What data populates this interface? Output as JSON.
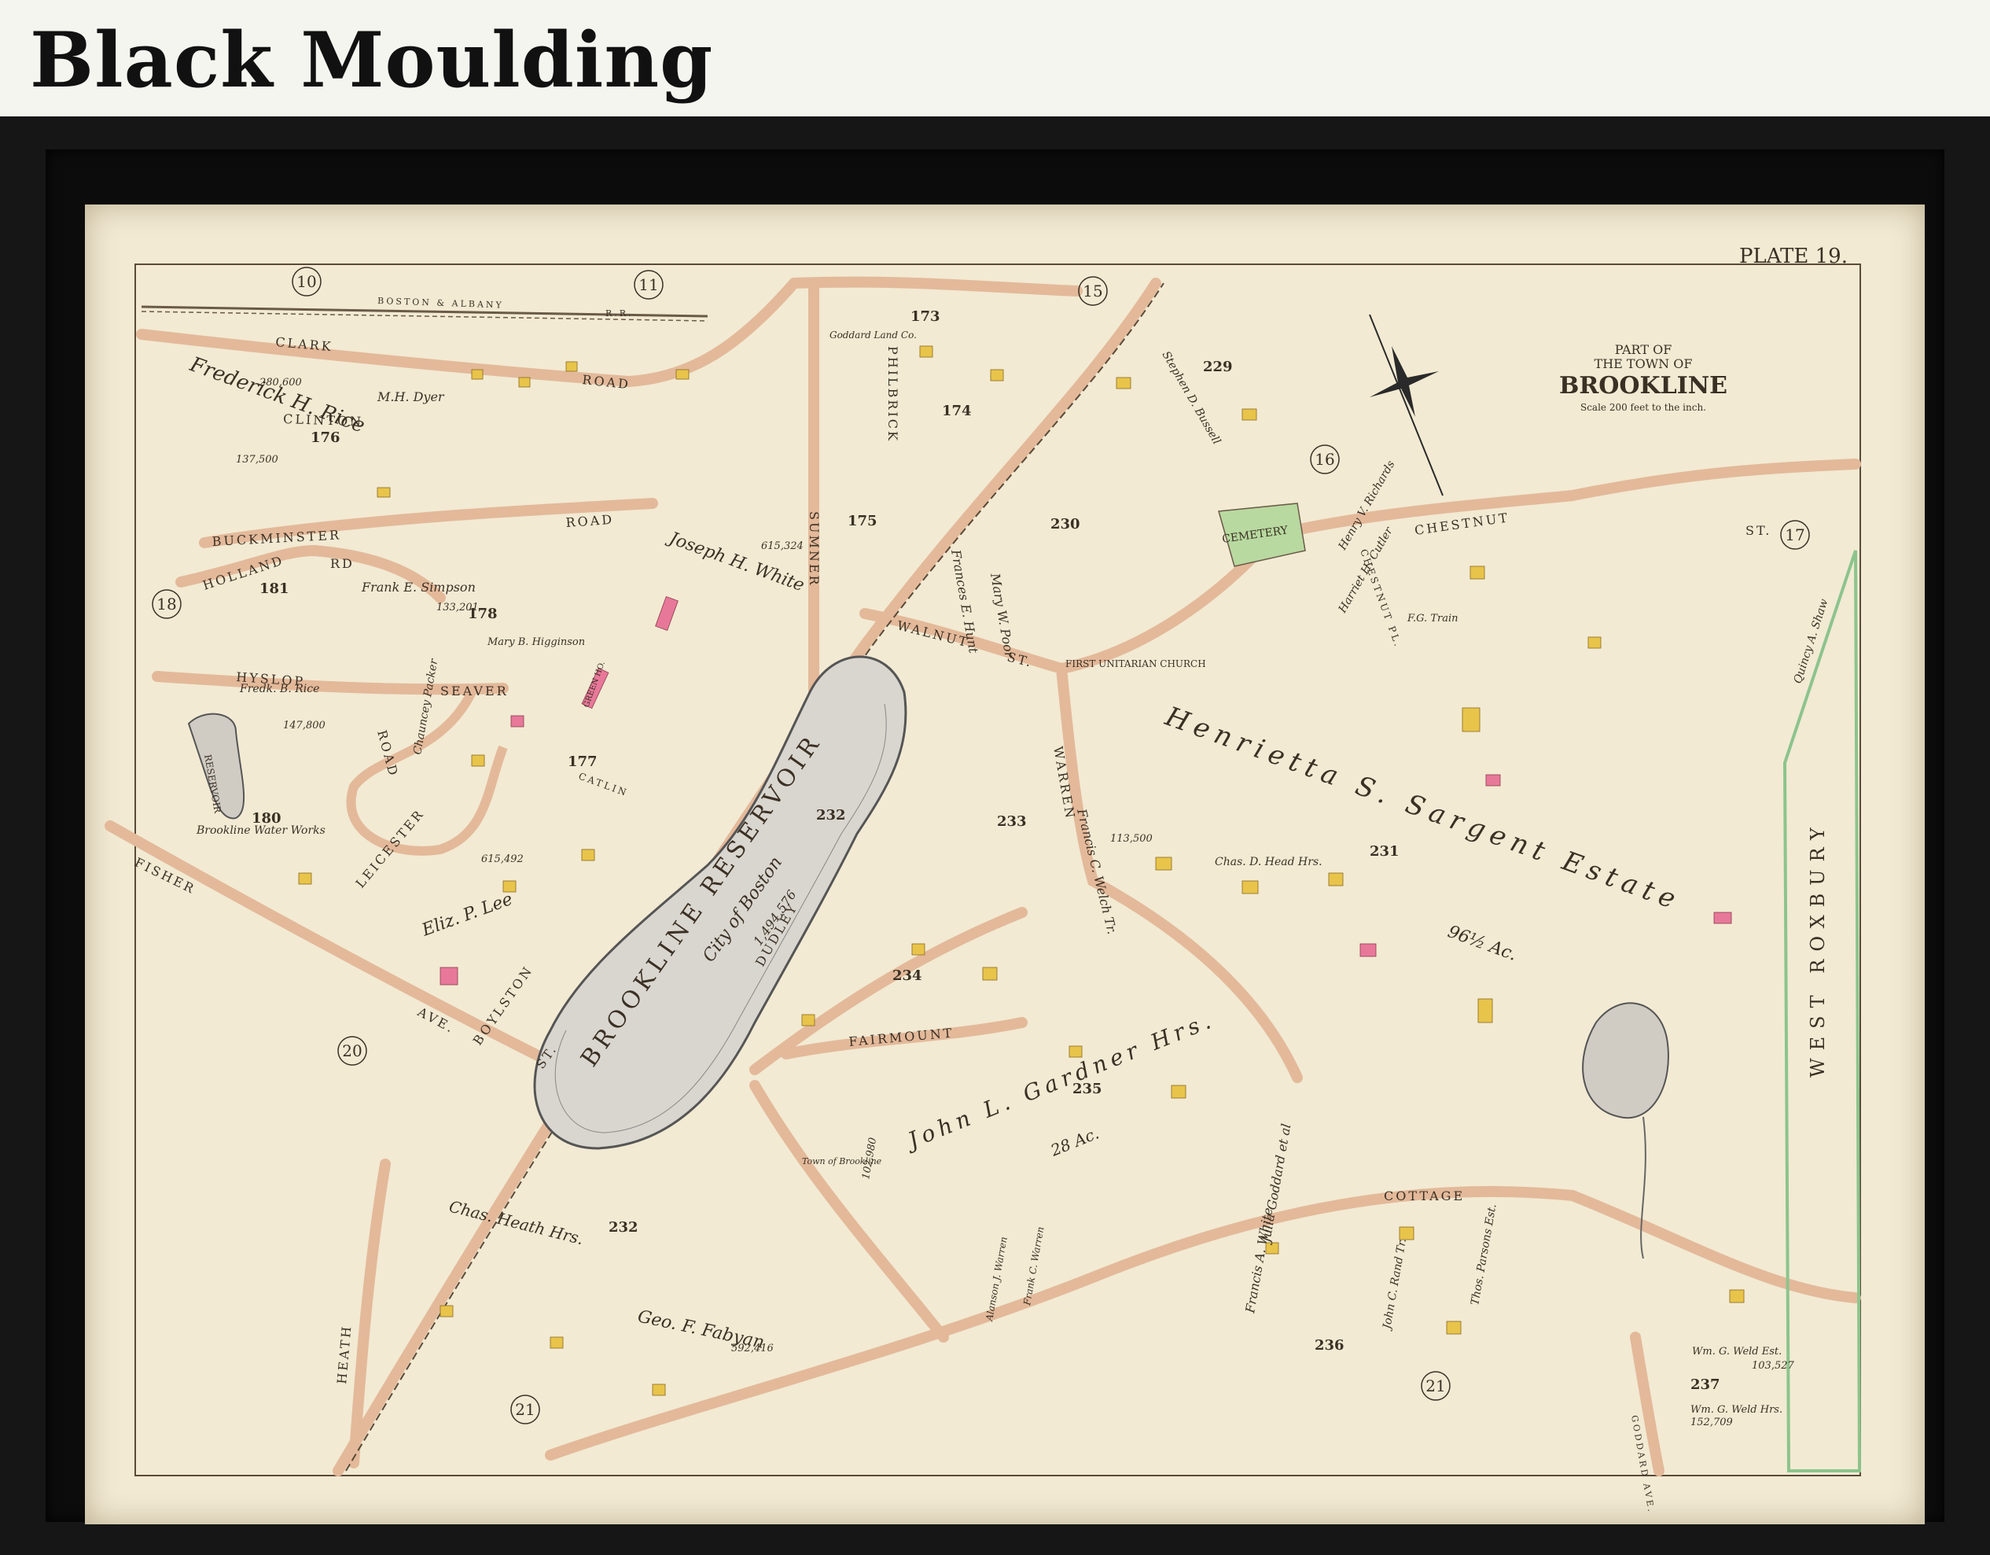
{
  "header": {
    "title": "Black Moulding"
  },
  "map": {
    "plate": "PLATE 19.",
    "cartouche": {
      "line1": "PART OF",
      "line2": "THE TOWN OF",
      "line3": "BROOKLINE",
      "scale": "Scale 200 feet to the inch."
    },
    "plate_refs": [
      "10",
      "11",
      "15",
      "16",
      "17",
      "18",
      "20",
      "21",
      "21"
    ],
    "block_numbers": [
      "176",
      "173",
      "174",
      "175",
      "178",
      "181",
      "177",
      "180",
      "229",
      "230",
      "231",
      "232",
      "233",
      "234",
      "235",
      "236",
      "237",
      "232"
    ],
    "streets": [
      "CLARK",
      "ROAD",
      "BOSTON & ALBANY",
      "R.R.",
      "CLINTON",
      "BUCKMINSTER",
      "ROAD",
      "HOLLAND",
      "RD",
      "HYSLOP",
      "SEAVER",
      "ROAD",
      "LEICESTER",
      "FISHER",
      "AVE.",
      "BOYLSTON",
      "ST.",
      "WALNUT",
      "ST.",
      "CHESTNUT",
      "ST.",
      "SUMNER",
      "PHILBRICK",
      "WARREN",
      "DUDLEY",
      "FAIRMOUNT",
      "COTTAGE",
      "HEATH",
      "GODDARD AVE.",
      "CHESTNUT PL.",
      "CATLIN",
      "WEST ROXBURY"
    ],
    "water": {
      "name": "BROOKLINE RESERVOIR",
      "sub": "City of Boston",
      "area": "1,494,576",
      "block": "232"
    },
    "owners": [
      "Frederick H. Rice",
      "M.H. Dyer",
      "Goddard Land Co.",
      "Joseph H. White",
      "Frank E. Simpson",
      "Mary W. Poor",
      "Frances E. Hunt",
      "Eliz. P. Lee",
      "Henrietta S. Sargent Estate",
      "96½ Ac.",
      "John L. Gardner Hrs.",
      "28 Ac.",
      "Chas. Heath Hrs.",
      "Geo. F. Fabyan",
      "Francis C. Welch Tr.",
      "Chas. D. Head Hrs.",
      "Frank E. Simpson",
      "Stephen D. Bussell",
      "Henry V. Richards",
      "Harriet H. Cutler",
      "F.G. Train",
      "Quincy A. Shaw",
      "Francis A. White",
      "Julia Goddard et al",
      "John C. Rand Tr.",
      "Thos. Parsons Est.",
      "Wm. G. Weld Est.",
      "Wm. G. Weld Hrs.",
      "Brookline Water Works",
      "Chauncey Packer",
      "Fredk. B. Rice",
      "Mary B. Higginson",
      "Frank C. Warren",
      "Town of Brookline",
      "Alanson J. Warren"
    ],
    "labels_misc": [
      "CEMETERY",
      "FIRST UNITARIAN CHURCH",
      "RESERVOIR",
      "GREEN HO."
    ],
    "areas": [
      "280,600",
      "137,500",
      "615,324",
      "133,201",
      "147,800",
      "615,492",
      "103,527",
      "152,709",
      "592,416",
      "113,500",
      "102,980"
    ]
  }
}
